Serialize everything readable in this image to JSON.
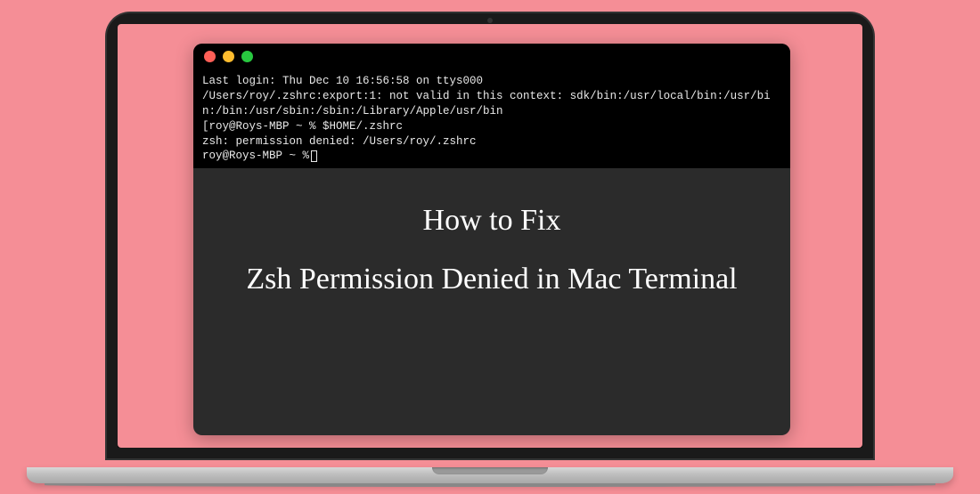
{
  "terminal": {
    "lines": [
      "Last login: Thu Dec 10 16:56:58 on ttys000",
      "/Users/roy/.zshrc:export:1: not valid in this context: sdk/bin:/usr/local/bin:/usr/bin:/bin:/usr/sbin:/sbin:/Library/Apple/usr/bin",
      "[roy@Roys-MBP ~ % $HOME/.zshrc",
      "zsh: permission denied: /Users/roy/.zshrc",
      "roy@Roys-MBP ~ %"
    ]
  },
  "overlay": {
    "line1": "How to Fix",
    "line2": "Zsh Permission Denied in Mac Terminal"
  },
  "traffic_lights": {
    "close": "close",
    "minimize": "minimize",
    "maximize": "maximize"
  }
}
